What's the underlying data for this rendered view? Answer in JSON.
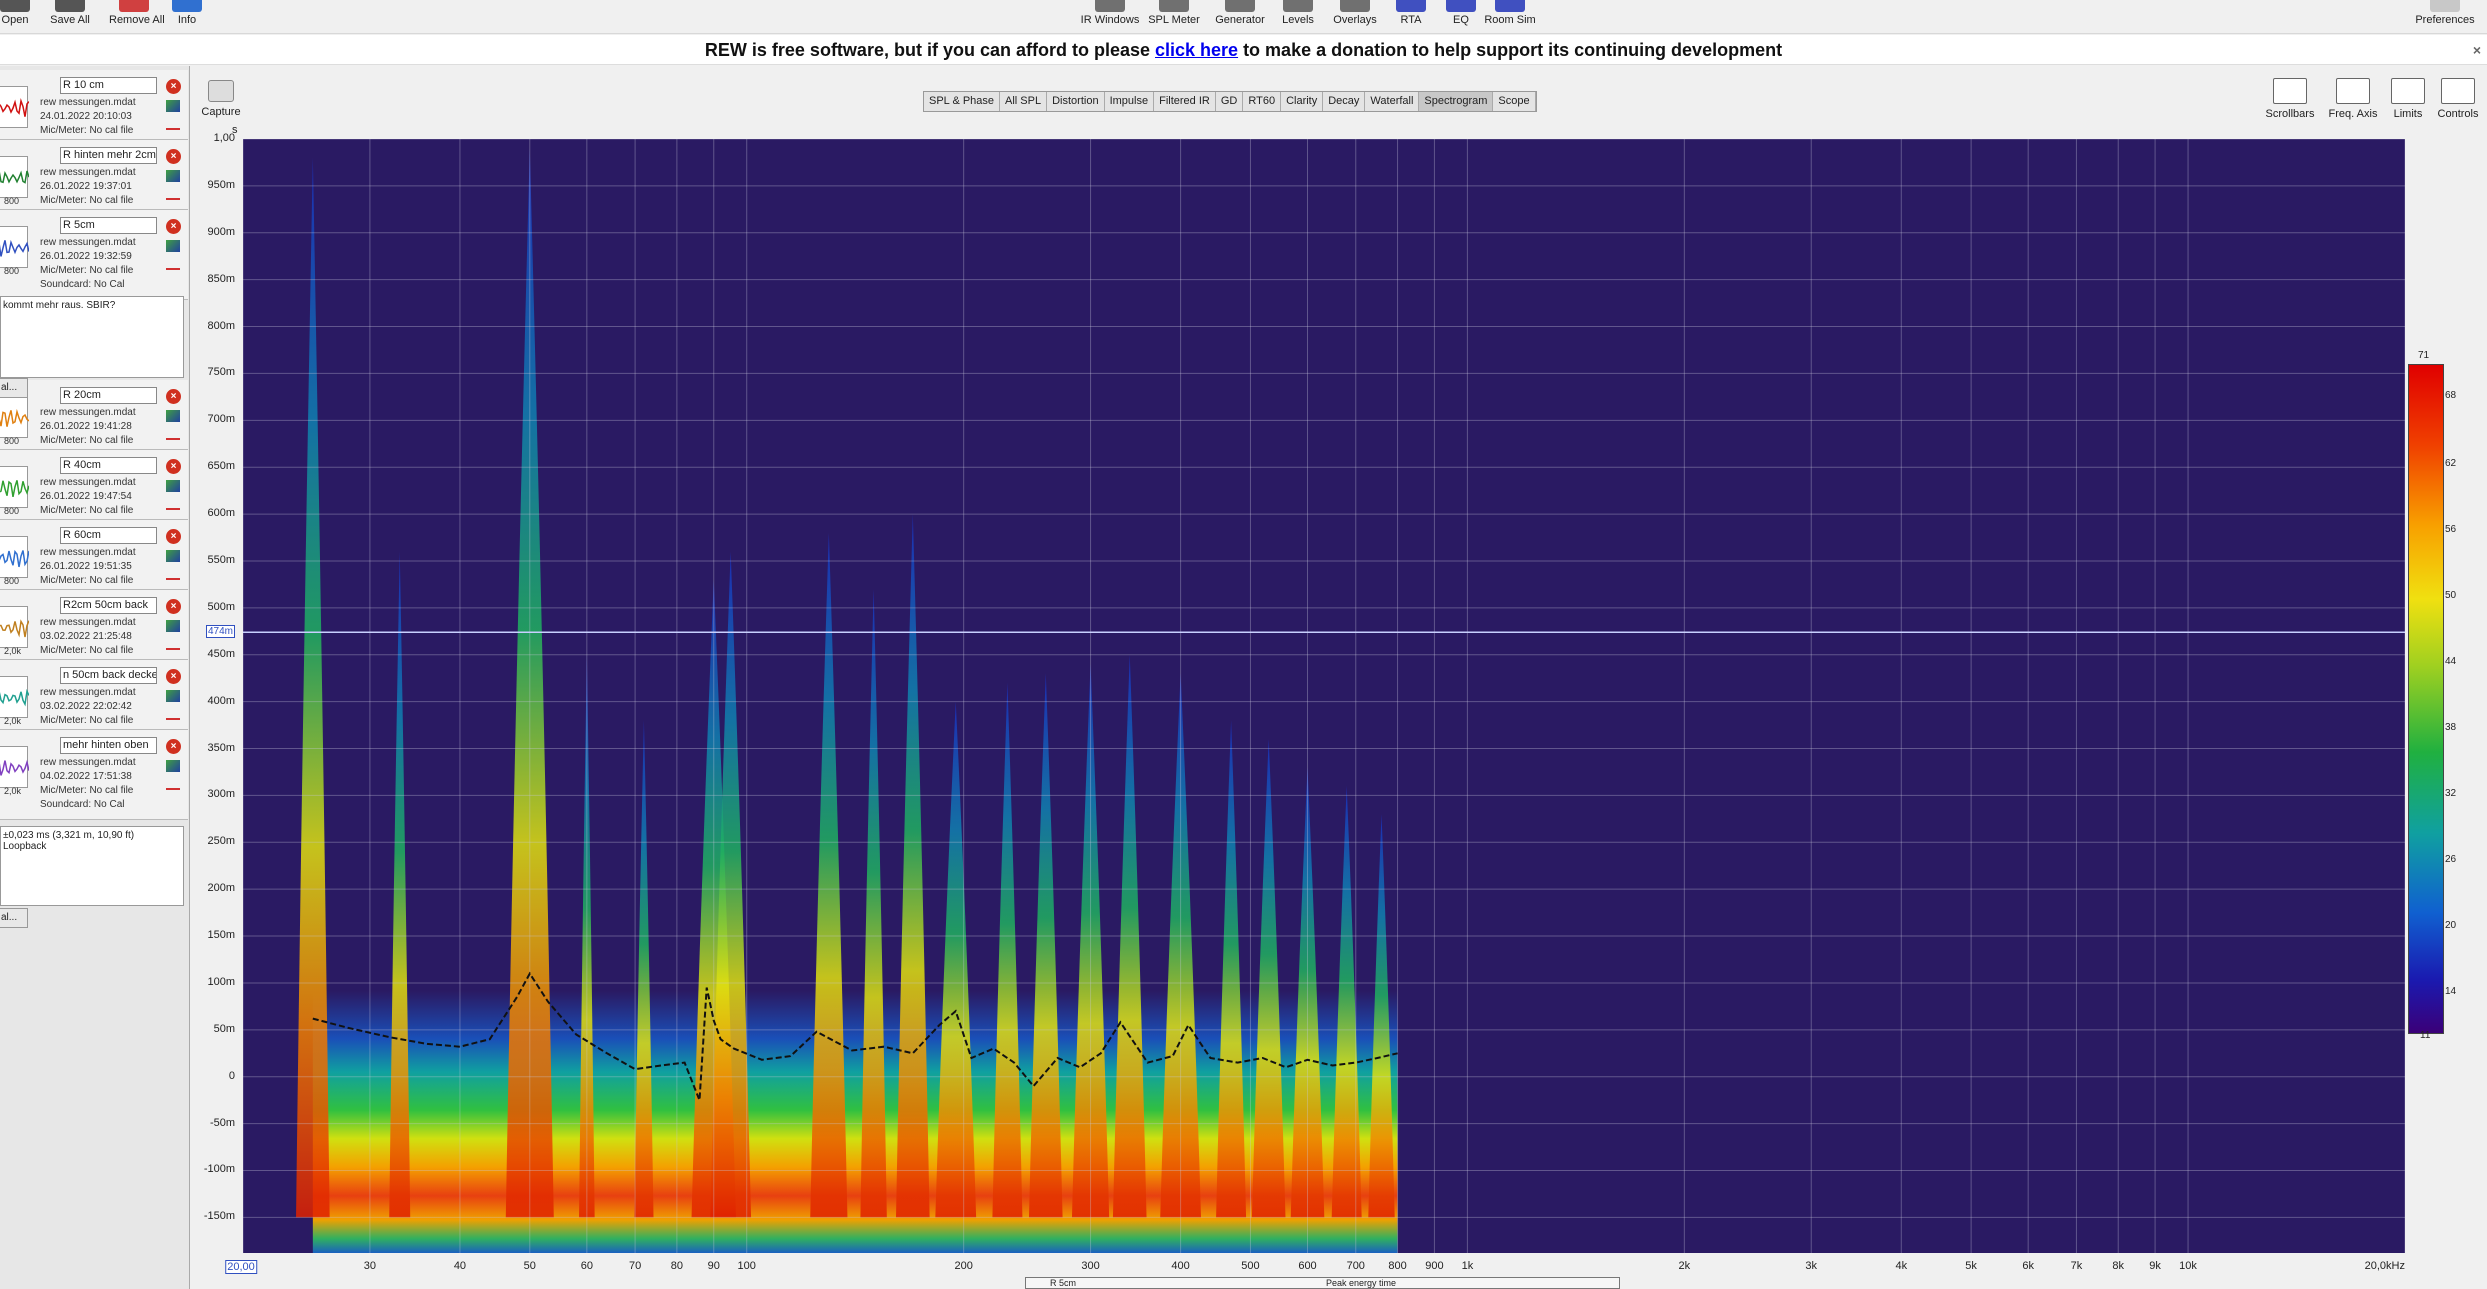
{
  "toolbar": {
    "left": [
      {
        "label": "Open",
        "icon": "folder-icon",
        "x": 15
      },
      {
        "label": "Save All",
        "icon": "save-icon",
        "x": 70
      },
      {
        "label": "Remove All",
        "icon": "remove-all-icon",
        "x": 134
      },
      {
        "label": "Info",
        "icon": "info-icon",
        "x": 187
      }
    ],
    "center": [
      {
        "label": "IR Windows",
        "icon": "ir-windows-icon"
      },
      {
        "label": "SPL Meter",
        "icon": "spl-meter-icon"
      },
      {
        "label": "Generator",
        "icon": "generator-icon"
      },
      {
        "label": "Levels",
        "icon": "levels-icon"
      },
      {
        "label": "Overlays",
        "icon": "overlays-icon"
      },
      {
        "label": "RTA",
        "icon": "rta-icon"
      },
      {
        "label": "EQ",
        "icon": "eq-icon"
      },
      {
        "label": "Room Sim",
        "icon": "room-sim-icon"
      }
    ],
    "preferences": "Preferences"
  },
  "banner": {
    "before": "REW is free software, but if you can afford to please ",
    "link": "click here",
    "after": " to make a donation to help support its continuing development",
    "close": "×"
  },
  "sidebar": {
    "measurements": [
      {
        "name": "R 10 cm",
        "file": "rew messungen.mdat",
        "date": "24.01.2022 20:10:03",
        "mic": "Mic/Meter: No cal file",
        "extra": "",
        "thumb_sub": "",
        "color": "#d01010"
      },
      {
        "name": "R hinten mehr 2cm",
        "file": "rew messungen.mdat",
        "date": "26.01.2022 19:37:01",
        "mic": "Mic/Meter: No cal file",
        "extra": "",
        "thumb_sub": "800",
        "color": "#208030"
      },
      {
        "name": "R 5cm",
        "file": "rew messungen.mdat",
        "date": "26.01.2022 19:32:59",
        "mic": "Mic/Meter: No cal file",
        "extra": "Soundcard: No Cal",
        "thumb_sub": "800",
        "color": "#3050c0"
      },
      {
        "name": "R 20cm",
        "file": "rew messungen.mdat",
        "date": "26.01.2022 19:41:28",
        "mic": "Mic/Meter: No cal file",
        "extra": "",
        "thumb_sub": "800",
        "color": "#e08010"
      },
      {
        "name": "R 40cm",
        "file": "rew messungen.mdat",
        "date": "26.01.2022 19:47:54",
        "mic": "Mic/Meter: No cal file",
        "extra": "",
        "thumb_sub": "800",
        "color": "#30a030"
      },
      {
        "name": "R 60cm",
        "file": "rew messungen.mdat",
        "date": "26.01.2022 19:51:35",
        "mic": "Mic/Meter: No cal file",
        "extra": "",
        "thumb_sub": "800",
        "color": "#3070d0"
      },
      {
        "name": "R2cm 50cm back",
        "file": "rew messungen.mdat",
        "date": "03.02.2022 21:25:48",
        "mic": "Mic/Meter: No cal file",
        "extra": "",
        "thumb_sub": "2,0k",
        "color": "#c08020"
      },
      {
        "name": "n 50cm back decke",
        "file": "rew messungen.mdat",
        "date": "03.02.2022 22:02:42",
        "mic": "Mic/Meter: No cal file",
        "extra": "",
        "thumb_sub": "2,0k",
        "color": "#20a090"
      },
      {
        "name": "mehr hinten oben",
        "file": "rew messungen.mdat",
        "date": "04.02.2022 17:51:38",
        "mic": "Mic/Meter: No cal file",
        "extra": "Soundcard: No Cal",
        "thumb_sub": "2,0k",
        "color": "#8040c0"
      }
    ],
    "notes1": "kommt mehr raus. SBIR?",
    "notes2_line1": "±0,023 ms (3,321 m, 10,90 ft)",
    "notes2_line2": "Loopback",
    "btn1": "al...",
    "btn2": "al..."
  },
  "capture": {
    "label": "Capture"
  },
  "axis_unit": "s",
  "tabs": [
    "SPL & Phase",
    "All SPL",
    "Distortion",
    "Impulse",
    "Filtered IR",
    "GD",
    "RT60",
    "Clarity",
    "Decay",
    "Waterfall",
    "Spectrogram",
    "Scope"
  ],
  "active_tab": "Spectrogram",
  "right_tools": [
    {
      "label": "Scrollbars",
      "icon": "scrollbars-icon"
    },
    {
      "label": "Freq. Axis",
      "icon": "freq-axis-icon"
    },
    {
      "label": "Limits",
      "icon": "limits-icon"
    },
    {
      "label": "Controls",
      "icon": "controls-icon"
    }
  ],
  "chart_data": {
    "type": "heatmap",
    "title": "",
    "xlabel": "",
    "ylabel": "s",
    "x_scale": "log",
    "xlim_hz": [
      20,
      20000
    ],
    "ylim_ms": [
      -188,
      1000
    ],
    "y_ticks": [
      "1,00",
      "950m",
      "900m",
      "850m",
      "800m",
      "750m",
      "700m",
      "650m",
      "600m",
      "550m",
      "500m",
      "450m",
      "400m",
      "350m",
      "300m",
      "250m",
      "200m",
      "150m",
      "100m",
      "50m",
      "0",
      "-50m",
      "-100m",
      "-150m"
    ],
    "x_ticks": [
      {
        "label": "20,00",
        "hz": 20
      },
      {
        "label": "30",
        "hz": 30
      },
      {
        "label": "40",
        "hz": 40
      },
      {
        "label": "50",
        "hz": 50
      },
      {
        "label": "60",
        "hz": 60
      },
      {
        "label": "70",
        "hz": 70
      },
      {
        "label": "80",
        "hz": 80
      },
      {
        "label": "90",
        "hz": 90
      },
      {
        "label": "100",
        "hz": 100
      },
      {
        "label": "200",
        "hz": 200
      },
      {
        "label": "300",
        "hz": 300
      },
      {
        "label": "400",
        "hz": 400
      },
      {
        "label": "500",
        "hz": 500
      },
      {
        "label": "600",
        "hz": 600
      },
      {
        "label": "700",
        "hz": 700
      },
      {
        "label": "800",
        "hz": 800
      },
      {
        "label": "900",
        "hz": 900
      },
      {
        "label": "1k",
        "hz": 1000
      },
      {
        "label": "2k",
        "hz": 2000
      },
      {
        "label": "3k",
        "hz": 3000
      },
      {
        "label": "4k",
        "hz": 4000
      },
      {
        "label": "5k",
        "hz": 5000
      },
      {
        "label": "6k",
        "hz": 6000
      },
      {
        "label": "7k",
        "hz": 7000
      },
      {
        "label": "8k",
        "hz": 8000
      },
      {
        "label": "9k",
        "hz": 9000
      },
      {
        "label": "10k",
        "hz": 10000
      },
      {
        "label": "20,0kHz",
        "hz": 20000
      }
    ],
    "cursor_label": "474m",
    "cursor_ms": 474,
    "data_extent_hz": [
      25,
      800
    ],
    "color_scale_db": [
      11,
      71
    ],
    "color_ticks": [
      "71",
      "68",
      "62",
      "56",
      "50",
      "44",
      "38",
      "32",
      "26",
      "20",
      "14",
      "11"
    ],
    "peak_energy_line": {
      "hz": [
        25,
        28,
        32,
        36,
        40,
        44,
        48,
        50,
        53,
        58,
        64,
        70,
        76,
        82,
        86,
        88,
        90,
        92,
        96,
        105,
        115,
        125,
        140,
        155,
        170,
        185,
        195,
        205,
        220,
        235,
        250,
        270,
        290,
        310,
        330,
        360,
        390,
        410,
        440,
        480,
        520,
        560,
        600,
        650,
        700,
        750,
        800
      ],
      "ms": [
        62,
        52,
        42,
        35,
        32,
        40,
        85,
        110,
        80,
        45,
        25,
        8,
        12,
        15,
        -25,
        95,
        60,
        40,
        30,
        18,
        22,
        48,
        28,
        32,
        25,
        55,
        70,
        20,
        30,
        15,
        -10,
        20,
        10,
        25,
        58,
        15,
        22,
        55,
        20,
        15,
        20,
        10,
        18,
        12,
        15,
        20,
        25
      ]
    },
    "resonances_hz": [
      25,
      33,
      50,
      60,
      72,
      90,
      95,
      130,
      150,
      170,
      195,
      230,
      260,
      300,
      340,
      400,
      470,
      530,
      600,
      680,
      760
    ],
    "resonance_peaks_ms": [
      980,
      560,
      990,
      450,
      380,
      530,
      560,
      580,
      520,
      600,
      400,
      420,
      430,
      440,
      450,
      430,
      380,
      360,
      330,
      310,
      280
    ],
    "resonance_strength_db": [
      62,
      55,
      70,
      52,
      54,
      68,
      66,
      64,
      58,
      62,
      66,
      60,
      62,
      64,
      62,
      66,
      60,
      62,
      62,
      60,
      58
    ]
  },
  "bottom_strip": {
    "left": "R 5cm",
    "right": "Peak energy time"
  }
}
